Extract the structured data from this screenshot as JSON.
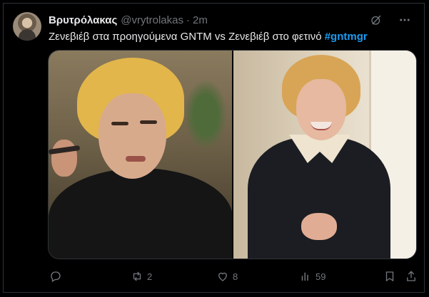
{
  "tweet": {
    "author": {
      "display_name": "Βρυτρόλακας",
      "handle": "@vrytrolakas",
      "separator": "·",
      "time": "2m"
    },
    "text": "Ζενεβιέβ στα προηγούμενα GNTM vs Ζενεβιέβ στο φετινό",
    "hashtag": "#gntmgr",
    "media": {
      "images": [
        {
          "description_icon": "photo-left"
        },
        {
          "description_icon": "photo-right"
        }
      ]
    },
    "stats": {
      "replies": "",
      "retweets": "2",
      "likes": "8",
      "views": "59"
    },
    "icons": {
      "grok": "grok-icon",
      "more": "more-icon",
      "reply": "reply-icon",
      "retweet": "retweet-icon",
      "like": "heart-icon",
      "views": "views-icon",
      "bookmark": "bookmark-icon",
      "share": "share-icon"
    }
  }
}
